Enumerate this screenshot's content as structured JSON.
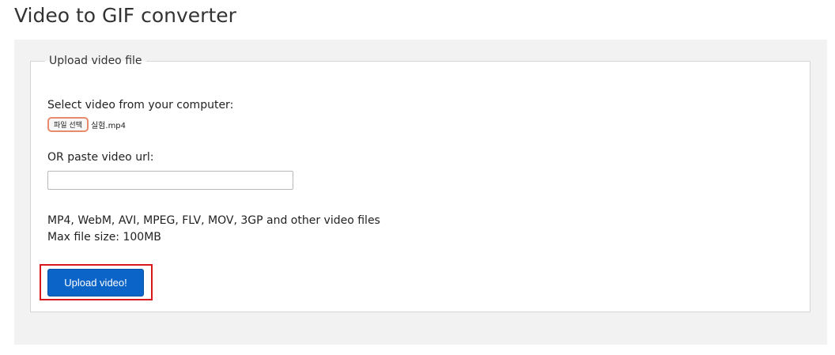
{
  "header": {
    "title": "Video to GIF converter"
  },
  "upload": {
    "legend": "Upload video file",
    "select_label": "Select video from your computer:",
    "file_button_label": "파일 선택",
    "file_name": "실험.mp4",
    "url_label": "OR paste video url:",
    "url_value": "",
    "formats_text": "MP4, WebM, AVI, MPEG, FLV, MOV, 3GP and other video files",
    "max_size_text": "Max file size: 100MB",
    "submit_label": "Upload video!"
  },
  "footer": {
    "partial_text": ""
  },
  "colors": {
    "primary_button": "#0b64c8",
    "highlight": "#d9181d",
    "file_button_border": "#e98a6b",
    "panel_bg": "#f2f2f3"
  }
}
